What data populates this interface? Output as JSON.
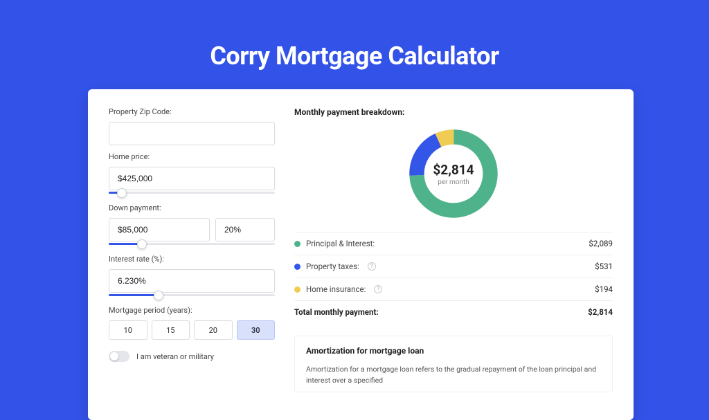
{
  "title": "Corry Mortgage Calculator",
  "form": {
    "zip": {
      "label": "Property Zip Code:",
      "value": ""
    },
    "home_price": {
      "label": "Home price:",
      "value": "$425,000",
      "slider_pct": 8
    },
    "down_payment": {
      "label": "Down payment:",
      "amount": "$85,000",
      "percent": "20%",
      "slider_pct": 20
    },
    "interest": {
      "label": "Interest rate (%):",
      "value": "6.230%",
      "slider_pct": 30
    },
    "period": {
      "label": "Mortgage period (years):",
      "options": [
        "10",
        "15",
        "20",
        "30"
      ],
      "active": "30"
    },
    "veteran": {
      "label": "I am veteran or military",
      "checked": false
    }
  },
  "breakdown": {
    "heading": "Monthly payment breakdown:",
    "center_amount": "$2,814",
    "center_sub": "per month",
    "items": [
      {
        "label": "Principal & Interest:",
        "value": "$2,089",
        "color": "#4eb38a",
        "help": false
      },
      {
        "label": "Property taxes:",
        "value": "$531",
        "color": "#3355e8",
        "help": true
      },
      {
        "label": "Home insurance:",
        "value": "$194",
        "color": "#f0cc52",
        "help": true
      }
    ],
    "total": {
      "label": "Total monthly payment:",
      "value": "$2,814"
    }
  },
  "chart_data": {
    "type": "pie",
    "title": "Monthly payment breakdown",
    "series": [
      {
        "name": "Principal & Interest",
        "value": 2089,
        "color": "#4eb38a"
      },
      {
        "name": "Property taxes",
        "value": 531,
        "color": "#3355e8"
      },
      {
        "name": "Home insurance",
        "value": 194,
        "color": "#f0cc52"
      }
    ],
    "total": 2814,
    "center_label": "$2,814 per month"
  },
  "amortization": {
    "heading": "Amortization for mortgage loan",
    "body": "Amortization for a mortgage loan refers to the gradual repayment of the loan principal and interest over a specified"
  }
}
